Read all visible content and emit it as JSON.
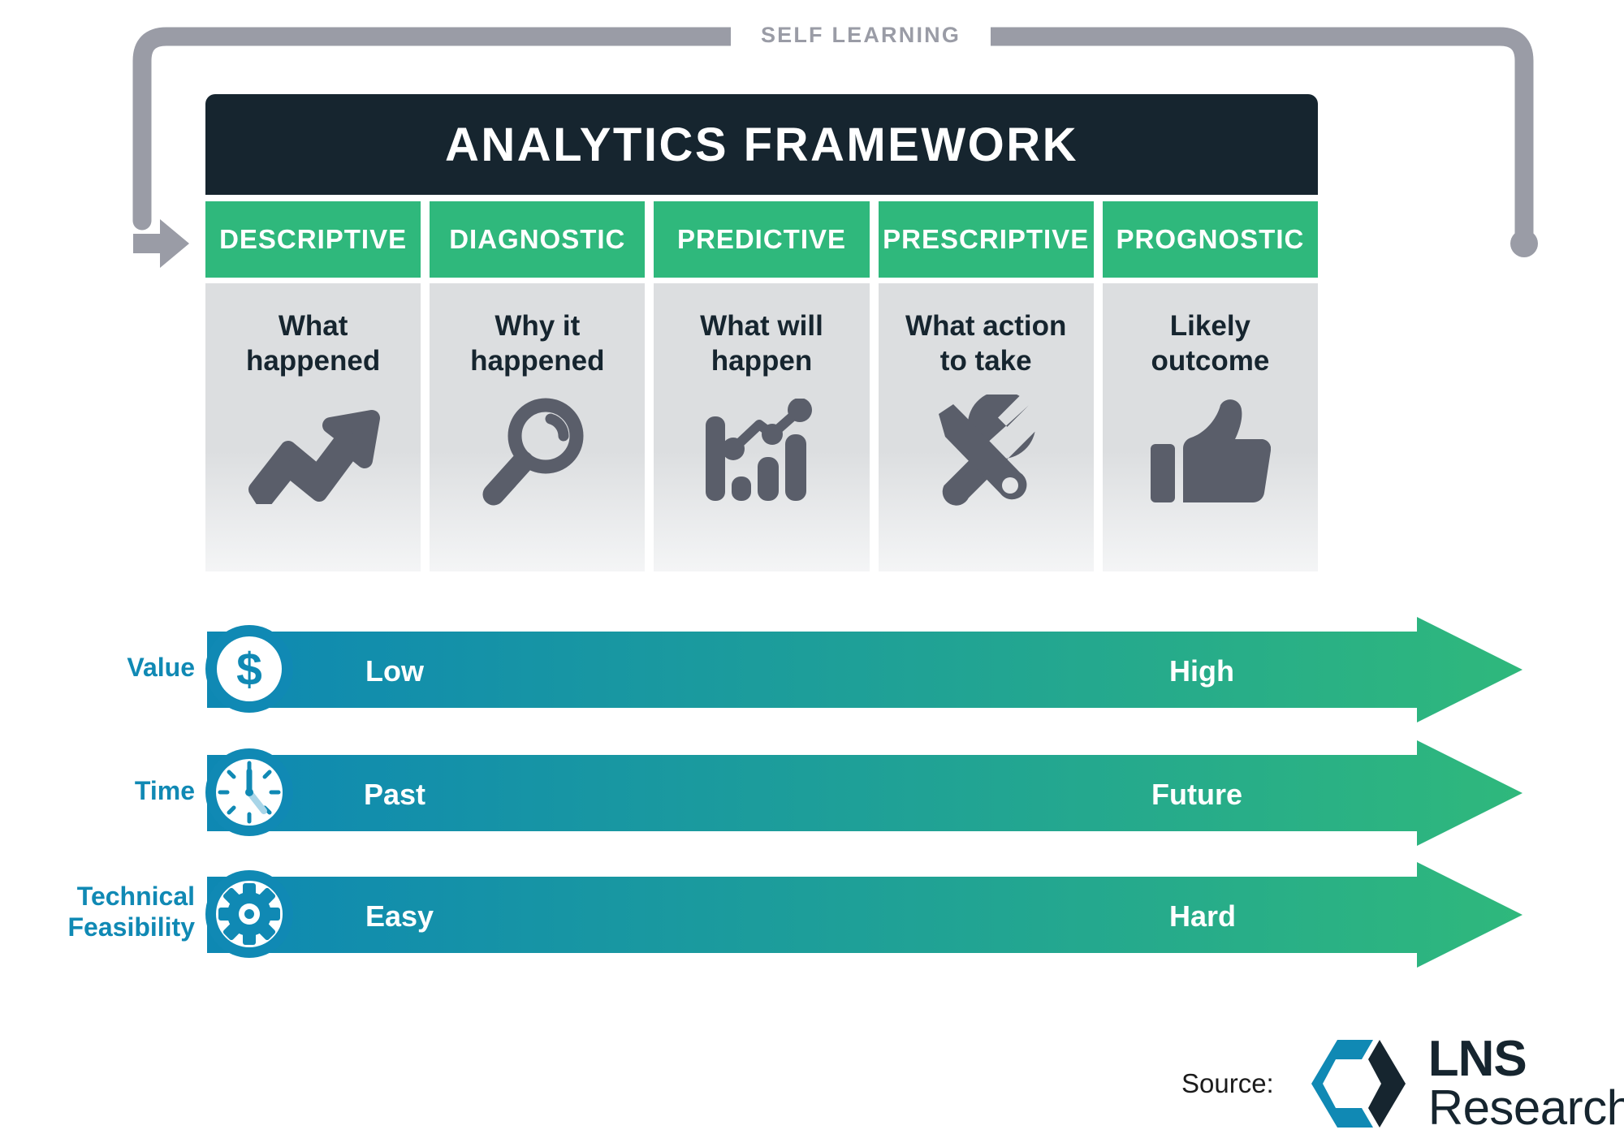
{
  "loop": {
    "label": "SELF LEARNING"
  },
  "header": {
    "title": "ANALYTICS FRAMEWORK"
  },
  "colors": {
    "navy": "#16252f",
    "green": "#2fb87c",
    "blue": "#1089b4",
    "gray_panel": "#dcdee0",
    "icon_gray": "#5a5e6a",
    "loop_gray": "#9a9ca6"
  },
  "columns": [
    {
      "head": "DESCRIPTIVE",
      "text": "What\nhappened",
      "icon": "trending-up-arrow-icon"
    },
    {
      "head": "DIAGNOSTIC",
      "text": "Why it\nhappened",
      "icon": "magnifier-icon"
    },
    {
      "head": "PREDICTIVE",
      "text": "What will\nhappen",
      "icon": "bar-chart-line-icon"
    },
    {
      "head": "PRESCRIPTIVE",
      "text": "What action\nto take",
      "icon": "wrench-screwdriver-icon"
    },
    {
      "head": "PROGNOSTIC",
      "text": "Likely\noutcome",
      "icon": "thumbs-up-icon"
    }
  ],
  "arrows": [
    {
      "label": "Value",
      "icon": "dollar-coin-icon",
      "left_text": "Low",
      "right_text": "High"
    },
    {
      "label": "Time",
      "icon": "clock-icon",
      "left_text": "Past",
      "right_text": "Future"
    },
    {
      "label": "Technical\nFeasibility",
      "icon": "gear-icon",
      "left_text": "Easy",
      "right_text": "Hard"
    }
  ],
  "source": {
    "label": "Source:",
    "logo_primary": "LNS",
    "logo_secondary": "Research"
  }
}
